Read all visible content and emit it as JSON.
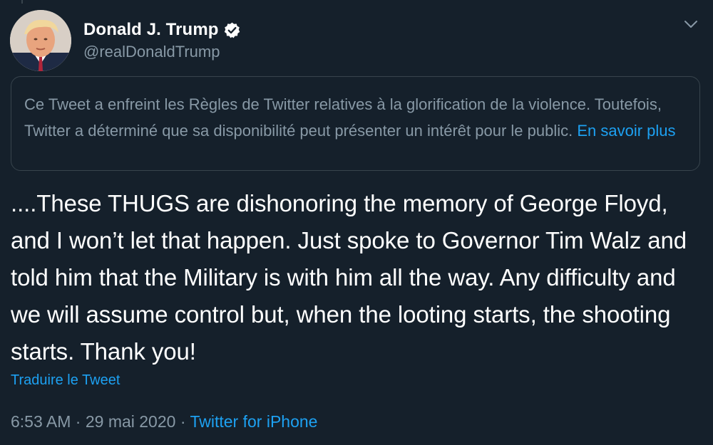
{
  "colors": {
    "background": "#15202b",
    "text_primary": "#ffffff",
    "text_secondary": "#8899a6",
    "link": "#1da1f2",
    "border": "#38444d"
  },
  "author": {
    "display_name": "Donald J. Trump",
    "handle": "@realDonaldTrump",
    "verified_icon": "verified-badge-icon"
  },
  "notice": {
    "text": "Ce Tweet a enfreint les Règles de Twitter relatives à la glorification de la violence. Toutefois, Twitter a déterminé que sa disponibilité peut présenter un intérêt pour le public.",
    "link_label": "En savoir plus"
  },
  "tweet": {
    "text": "....These THUGS are dishonoring the memory of George Floyd, and I won’t let that happen. Just spoke to Governor Tim Walz and told him that the Military is with him all the way. Any difficulty and we will assume control but, when the looting starts, the shooting starts. Thank you!",
    "translate_label": "Traduire le Tweet",
    "time": "6:53 AM",
    "separator": "·",
    "date": "29 mai 2020",
    "source": "Twitter for iPhone"
  },
  "menu_icon": "chevron-down-icon"
}
